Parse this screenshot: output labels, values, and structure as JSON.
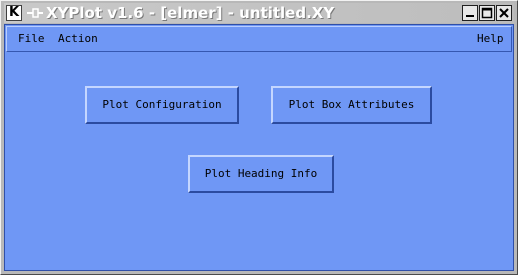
{
  "window": {
    "title": "XYPlot v1.6 - [elmer] - untitled.XY",
    "app_icon_glyph": "K",
    "controls": {
      "minimize": "minimize-icon",
      "maximize": "maximize-icon",
      "close": "close-icon"
    }
  },
  "menubar": {
    "file": "File",
    "action": "Action",
    "help": "Help"
  },
  "buttons": {
    "plot_configuration": "Plot Configuration",
    "plot_box_attributes": "Plot Box Attributes",
    "plot_heading_info": "Plot Heading Info"
  },
  "colors": {
    "client_background": "#6f97f5",
    "title_text": "#ffffff"
  }
}
